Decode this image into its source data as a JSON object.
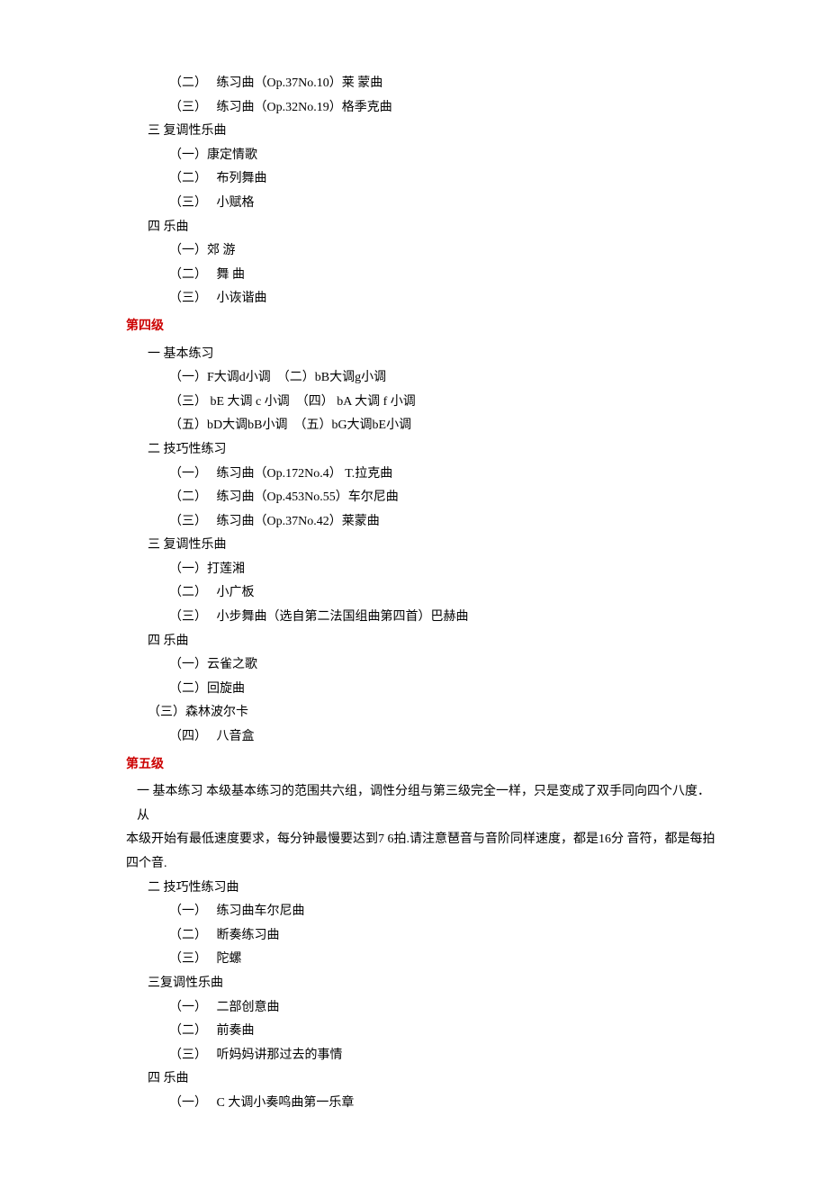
{
  "pre_level3": {
    "etudes": [
      "（二）　 练习曲（Op.37No.10）莱 蒙曲",
      "（三）　 练习曲（Op.32No.19）格季克曲"
    ],
    "polyphonic": {
      "title": "三 复调性乐曲",
      "items": [
        "（一）康定情歌",
        "（二）　 布列舞曲",
        "（三）　 小赋格"
      ]
    },
    "pieces": {
      "title": "四 乐曲",
      "items": [
        "（一）郊  游",
        "（二）　 舞  曲",
        "（三）　 小诙谐曲"
      ]
    }
  },
  "level4": {
    "heading": "第四级",
    "basic": {
      "title": "一 基本练习",
      "lines": [
        "（一）F大调d小调　（二）bB大调g小调",
        "（三） bE 大调 c 小调　（四） bA 大调 f 小调",
        "（五）bD大调bB小调　（五）bG大调bE小调"
      ]
    },
    "technique": {
      "title": "二 技巧性练习",
      "items": [
        "（一）　 练习曲（Op.172No.4） T.拉克曲",
        "（二）　 练习曲（Op.453No.55）车尔尼曲",
        "（三）　 练习曲（Op.37No.42）莱蒙曲"
      ]
    },
    "polyphonic": {
      "title": "三 复调性乐曲",
      "items": [
        "（一）打莲湘",
        "（二）　 小广板",
        "（三）　 小步舞曲（选自第二法国组曲第四首）巴赫曲"
      ]
    },
    "pieces": {
      "title": "四 乐曲",
      "items": [
        "（一）云雀之歌",
        "（二）回旋曲"
      ],
      "item3": "（三）森林波尔卡",
      "item4": "（四）　 八音盒"
    }
  },
  "level5": {
    "heading": "第五级",
    "basic_line1": "一  基本练习 本级基本练习的范围共六组，调性分组与第三级完全一样，只是变成了双手同向四个八度．从",
    "basic_line2": "本级开始有最低速度要求，每分钟最慢要达到7 6拍.请注意琶音与音阶同样速度，都是16分 音符，都是每拍四个音.",
    "technique": {
      "title": "二 技巧性练习曲",
      "items": [
        "（一）　 练习曲车尔尼曲",
        "（二）　 断奏练习曲",
        "（三）　 陀螺"
      ]
    },
    "polyphonic": {
      "title": "三复调性乐曲",
      "items": [
        "（一）　 二部创意曲",
        "（二）　 前奏曲",
        "（三）　 听妈妈讲那过去的事情"
      ]
    },
    "pieces": {
      "title": "四  乐曲",
      "items": [
        "（一）　 C 大调小奏鸣曲第一乐章"
      ]
    }
  }
}
